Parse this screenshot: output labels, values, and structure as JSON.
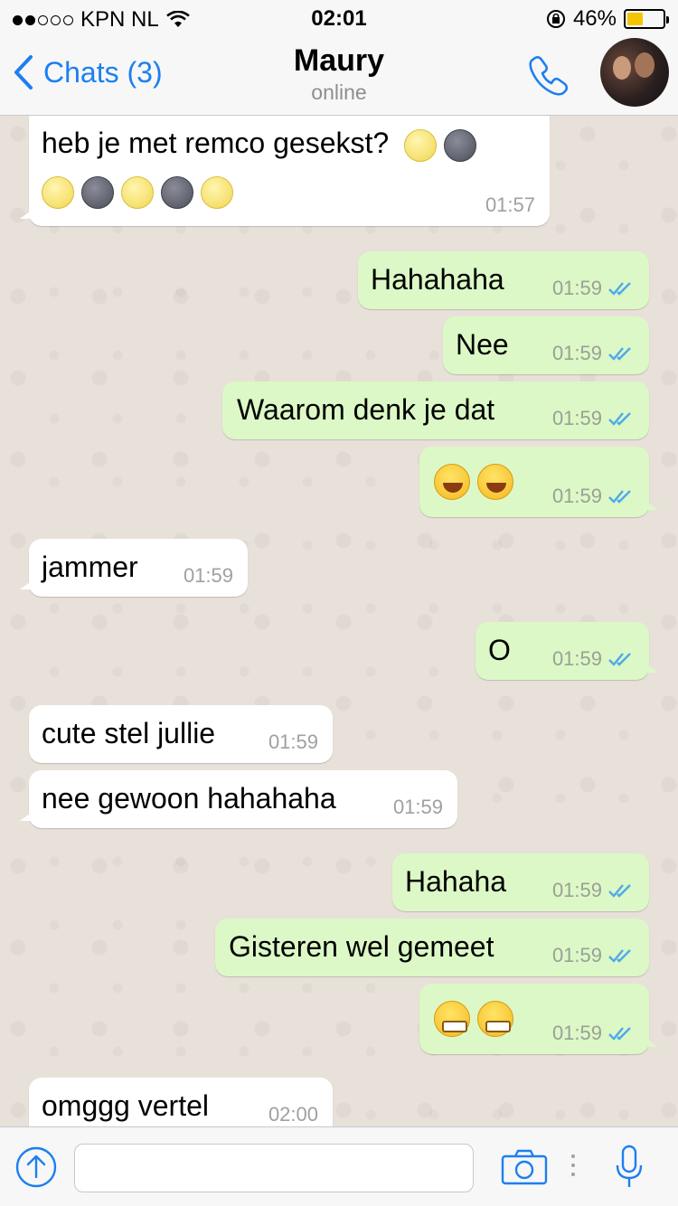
{
  "status_bar": {
    "carrier": "KPN NL",
    "time": "02:01",
    "battery_percent": "46%",
    "battery_level": 0.46,
    "signal_bars": 2
  },
  "nav": {
    "back_label": "Chats (3)",
    "contact_name": "Maury",
    "contact_status": "online"
  },
  "messages": [
    {
      "dir": "in",
      "text": "heb je met remco gesekst?",
      "time": "01:57"
    },
    {
      "dir": "out",
      "text": "Hahahaha",
      "time": "01:59"
    },
    {
      "dir": "out",
      "text": "Nee",
      "time": "01:59"
    },
    {
      "dir": "out",
      "text": "Waarom denk je dat",
      "time": "01:59"
    },
    {
      "dir": "out",
      "text": "",
      "time": "01:59"
    },
    {
      "dir": "in",
      "text": "jammer",
      "time": "01:59"
    },
    {
      "dir": "out",
      "text": "O",
      "time": "01:59"
    },
    {
      "dir": "in",
      "text": "cute stel jullie",
      "time": "01:59"
    },
    {
      "dir": "in",
      "text": "nee gewoon hahahaha",
      "time": "01:59"
    },
    {
      "dir": "out",
      "text": "Hahaha",
      "time": "01:59"
    },
    {
      "dir": "out",
      "text": "Gisteren wel gemeet",
      "time": "01:59"
    },
    {
      "dir": "out",
      "text": "",
      "time": "01:59"
    },
    {
      "dir": "in",
      "text": "omggg vertel",
      "time": "02:00"
    }
  ],
  "input": {
    "value": "",
    "placeholder": ""
  },
  "colors": {
    "accent": "#1d7ff0",
    "outgoing_bubble": "#dcf8c6",
    "incoming_bubble": "#ffffff",
    "read_ticks": "#4fa9e8"
  },
  "icons": {
    "back": "chevron-left-icon",
    "call": "phone-icon",
    "upload": "upload-arrow-icon",
    "camera": "camera-icon",
    "mic": "microphone-icon",
    "read": "double-check-icon"
  }
}
